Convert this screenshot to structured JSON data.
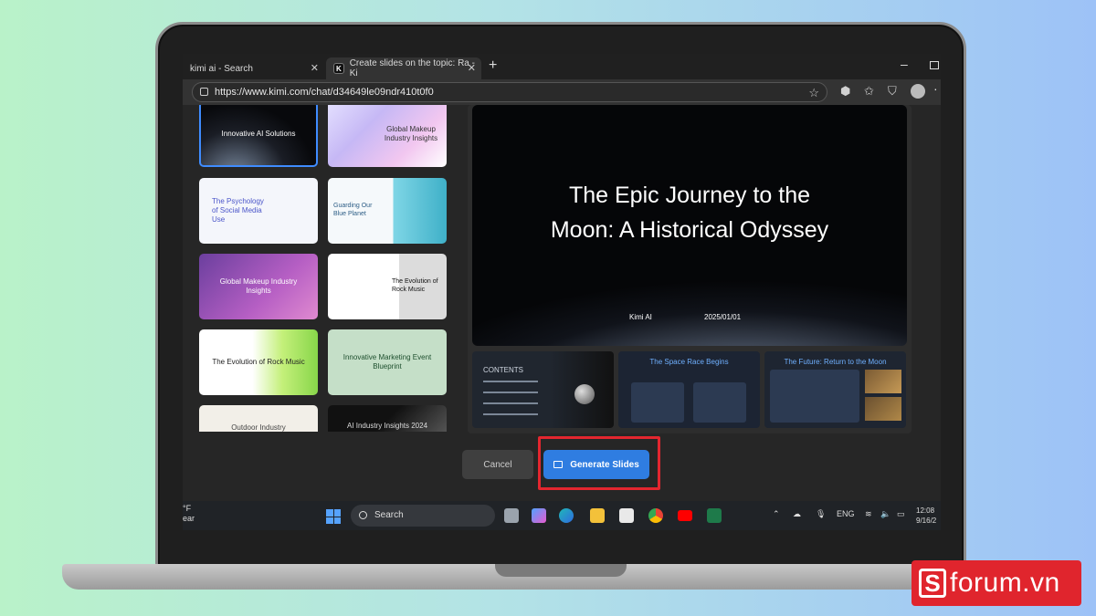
{
  "browser": {
    "tabs": [
      {
        "label": "kimi ai - Search"
      },
      {
        "label": "Create slides on the topic: Ra - Ki"
      }
    ],
    "address": "https://www.kimi.com/chat/d34649le09ndr410t0f0",
    "tab_icon_letter": "K"
  },
  "gallery": {
    "items": [
      {
        "label": "Innovative AI Solutions"
      },
      {
        "label": "Global Makeup Industry Insights"
      },
      {
        "label": "The Psychology of Social Media Use"
      },
      {
        "label": "Guarding Our Blue Planet"
      },
      {
        "label": "Global Makeup Industry Insights"
      },
      {
        "label": "The Evolution of Rock Music"
      },
      {
        "label": "The Evolution of Rock Music"
      },
      {
        "label": "Innovative Marketing Event Blueprint"
      },
      {
        "label": "Outdoor Industry"
      },
      {
        "label": "AI Industry Insights 2024"
      }
    ]
  },
  "preview": {
    "title_line1": "The Epic Journey to the",
    "title_line2": "Moon: A Historical Odyssey",
    "author": "Kimi AI",
    "date": "2025/01/01",
    "slides": [
      {
        "title": "CONTENTS"
      },
      {
        "title": "The Space Race Begins"
      },
      {
        "title": "The Future: Return to the Moon"
      }
    ]
  },
  "actions": {
    "cancel": "Cancel",
    "generate": "Generate Slides"
  },
  "taskbar": {
    "weather_line1": "°F",
    "weather_line2": "ear",
    "search": "Search",
    "language": "ENG",
    "time": "12:08",
    "date": "9/16/2"
  },
  "brand": {
    "letter": "S",
    "name": "forum.vn",
    "color": "#e0252d"
  }
}
